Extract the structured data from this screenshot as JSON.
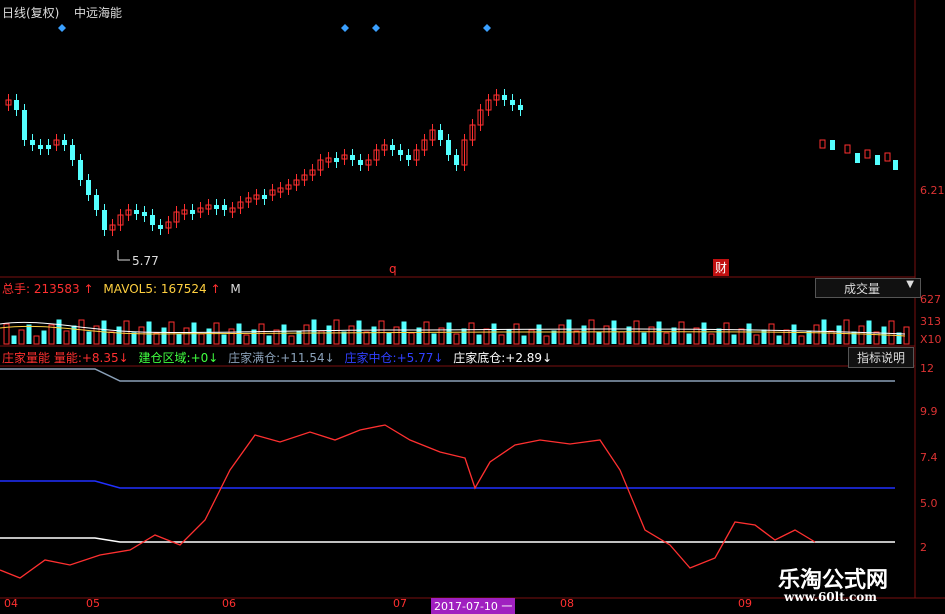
{
  "header": {
    "period": "日线(复权)",
    "stock_name": "中远海能"
  },
  "price_panel": {
    "low_marker": "5.77",
    "right_price": "6.21",
    "event_markers": [
      "q",
      "财"
    ]
  },
  "volume_panel": {
    "total_label": "总手:",
    "total_value": "213583",
    "mavol_label": "MAVOL5:",
    "mavol_value": "167524",
    "m_label": "M",
    "dropdown": "成交量",
    "axis": [
      "627",
      "313",
      "X10"
    ]
  },
  "indicator_panel": {
    "items": [
      {
        "label": "庄家量能 量能:",
        "value": "+8.35",
        "color": "#ff3030"
      },
      {
        "label": "建仓区域:",
        "value": "+0",
        "color": "#ff3030"
      },
      {
        "label": "庄家满仓:",
        "value": "+11.54",
        "color": "#8aa0b8"
      },
      {
        "label": "庄家中仓:",
        "value": "+5.77",
        "color": "#2030ff"
      },
      {
        "label": "庄家底仓:",
        "value": "+2.89",
        "color": "#ffffff"
      }
    ],
    "help_button": "指标说明",
    "axis": [
      "12",
      "9.9",
      "7.4",
      "5.0",
      "2"
    ]
  },
  "date_axis": {
    "labels": [
      "04",
      "05",
      "06",
      "07",
      "08",
      "09"
    ],
    "highlight": "2017-07-10 一"
  },
  "watermark": {
    "name": "乐淘公式网",
    "url": "www.60lt.com"
  },
  "colors": {
    "up": "#ff3030",
    "down": "#54ffff",
    "axis_text": "#ff3030"
  }
}
